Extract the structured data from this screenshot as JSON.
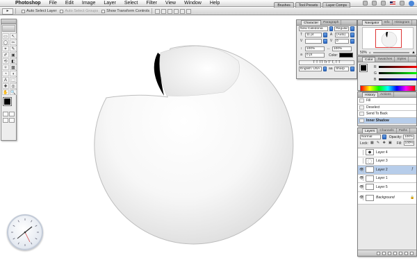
{
  "menubar": {
    "app": "Photoshop",
    "items": [
      "File",
      "Edit",
      "Image",
      "Layer",
      "Select",
      "Filter",
      "View",
      "Window",
      "Help"
    ]
  },
  "options": {
    "auto_select_layer": "Auto Select Layer",
    "auto_select_groups": "Auto Select Groups",
    "show_transform_controls": "Show Transform Controls"
  },
  "wells": [
    "Brushes",
    "Tool Presets",
    "Layer Comps"
  ],
  "toolbox": {
    "tools": [
      "▭",
      "↖",
      "◯",
      "✂",
      "⌖",
      "✎",
      "✐",
      "▣",
      "⟲",
      "◧",
      "✧",
      "▩",
      "◔",
      "◖",
      "A",
      "⬚",
      "✚",
      "◎",
      "✋",
      "🔍"
    ]
  },
  "character": {
    "tabs": [
      "Character",
      "Paragraph"
    ],
    "font_family": "New Caledonia",
    "font_style": "Regular",
    "size": "11 pt",
    "leading": "(Auto)",
    "tracking": "",
    "kerning": "0",
    "vscale": "100%",
    "hscale": "100%",
    "baseline": "0 pt",
    "color_label": "Color:",
    "language": "English: USA",
    "antialias": "Sharp"
  },
  "navigator": {
    "tabs": [
      "Navigator",
      "Info",
      "Histogram"
    ],
    "zoom": "50%"
  },
  "color": {
    "tabs": [
      "Color",
      "Swatches",
      "Styles"
    ],
    "channels": [
      {
        "label": "R",
        "value": "0"
      },
      {
        "label": "G",
        "value": "0"
      },
      {
        "label": "B",
        "value": "0"
      }
    ]
  },
  "history": {
    "tabs": [
      "History",
      "Actions"
    ],
    "items": [
      {
        "label": "Fill",
        "selected": false
      },
      {
        "label": "Deselect",
        "selected": false
      },
      {
        "label": "Send To Back",
        "selected": false
      },
      {
        "label": "Inner Shadow",
        "selected": true
      }
    ]
  },
  "layers": {
    "tabs": [
      "Layers",
      "Channels",
      "Paths"
    ],
    "blend_mode": "Normal",
    "opacity_label": "Opacity:",
    "opacity": "100%",
    "lock_label": "Lock:",
    "fill_label": "Fill:",
    "fill": "100%",
    "items": [
      {
        "name": "Layer 4",
        "visible": false,
        "selected": false
      },
      {
        "name": "Layer 3",
        "visible": false,
        "selected": false
      },
      {
        "name": "Layer 2",
        "visible": true,
        "selected": true
      },
      {
        "name": "Layer 1",
        "visible": true,
        "selected": false
      },
      {
        "name": "Layer 5",
        "visible": true,
        "selected": false
      },
      {
        "name": "Background",
        "visible": true,
        "selected": false
      }
    ]
  },
  "colors": {
    "accent": "#b7cdea",
    "foreground": "#000000",
    "background": "#ffffff"
  }
}
